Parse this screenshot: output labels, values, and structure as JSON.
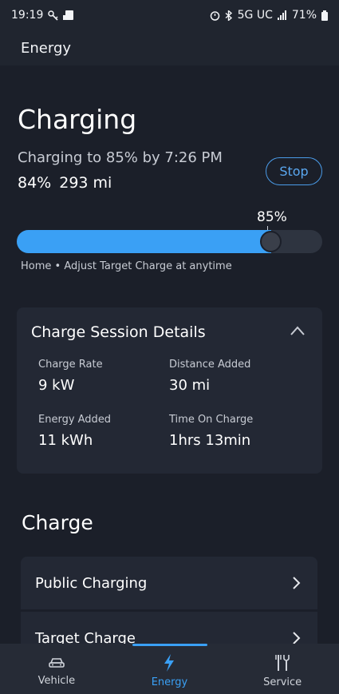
{
  "status_bar": {
    "time": "19:19",
    "network": "5G UC",
    "battery": "71%"
  },
  "header": {
    "title": "Energy"
  },
  "charging": {
    "title": "Charging",
    "subtitle": "Charging to 85% by 7:26 PM",
    "percent": "84%",
    "range": "293 mi",
    "stop_label": "Stop",
    "target_label": "85%",
    "current_level": 0.84,
    "target_level": 0.85,
    "caption": "Home • Adjust Target Charge at anytime"
  },
  "session": {
    "title": "Charge Session Details",
    "details": [
      {
        "label": "Charge Rate",
        "value": "9 kW"
      },
      {
        "label": "Distance Added",
        "value": "30 mi"
      },
      {
        "label": "Energy Added",
        "value": "11 kWh"
      },
      {
        "label": "Time On Charge",
        "value": "1hrs 13min"
      }
    ]
  },
  "charge_section": {
    "title": "Charge",
    "items": [
      {
        "label": "Public Charging"
      },
      {
        "label": "Target Charge"
      }
    ]
  },
  "nav": {
    "items": [
      {
        "label": "Vehicle",
        "icon": "car-icon"
      },
      {
        "label": "Energy",
        "icon": "bolt-icon"
      },
      {
        "label": "Service",
        "icon": "tools-icon"
      }
    ],
    "active": "Energy"
  },
  "colors": {
    "accent": "#3aa0f5",
    "background": "#1b1f29",
    "card": "#232834"
  }
}
